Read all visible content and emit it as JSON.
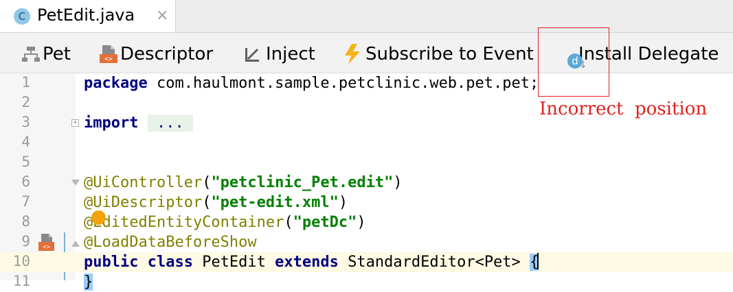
{
  "tab": {
    "file_icon_letter": "C",
    "label": "PetEdit.java",
    "close_glyph": "×"
  },
  "toolbar": {
    "items": [
      {
        "label": "Pet",
        "icon": "entity-icon"
      },
      {
        "label": "Descriptor",
        "icon": "descriptor-icon"
      },
      {
        "label": "Inject",
        "icon": "inject-icon"
      },
      {
        "label": "Subscribe to Event",
        "icon": "lightning-icon"
      },
      {
        "label": "Install Delegate",
        "icon": "delegate-icon"
      }
    ],
    "delegate_badge_letter": "d"
  },
  "editor": {
    "current_line": 10,
    "lines": [
      {
        "n": "1",
        "text": "package com.haulmont.sample.petclinic.web.pet.pet;"
      },
      {
        "n": "2",
        "text": ""
      },
      {
        "n": "3",
        "text": "import ..."
      },
      {
        "n": "4",
        "text": ""
      },
      {
        "n": "5",
        "text": ""
      },
      {
        "n": "6",
        "text": "@UiController(\"petclinic_Pet.edit\")"
      },
      {
        "n": "7",
        "text": "@UiDescriptor(\"pet-edit.xml\")"
      },
      {
        "n": "8",
        "text": "@EditedEntityContainer(\"petDc\")"
      },
      {
        "n": "9",
        "text": "@LoadDataBeforeShow"
      },
      {
        "n": "10",
        "text": "public class PetEdit extends StandardEditor<Pet> {"
      },
      {
        "n": "11",
        "text": "}"
      }
    ]
  },
  "annotation": {
    "note": "Incorrect  position",
    "color": "#e02020"
  },
  "colors": {
    "keyword": "#000080",
    "string": "#008000",
    "annotation": "#808000",
    "current_line_bg": "#fefae4",
    "brace_highlight": "#99ccff",
    "intention_bulb": "#f0a30a"
  }
}
